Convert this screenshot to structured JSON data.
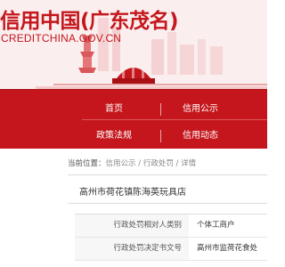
{
  "header": {
    "site_title": "信用中国(广东茂名)",
    "site_domain": "CREDITCHINA.GOV.CN"
  },
  "nav": {
    "items": [
      {
        "label": "首页"
      },
      {
        "label": "信用公示"
      },
      {
        "label": "政策法规"
      },
      {
        "label": "信用动态"
      }
    ]
  },
  "breadcrumb": {
    "lead": "当前位置：",
    "items": [
      "信用公示",
      "行政处罚",
      "详情"
    ],
    "separator": " / "
  },
  "record": {
    "title": "高州市荷花镇陈海英玩具店",
    "fields": [
      {
        "key": "行政处罚相对人类别",
        "value": "个体工商户"
      },
      {
        "key": "行政处罚决定书文号",
        "value": "高州市监荷花食处"
      }
    ]
  },
  "colors": {
    "brand_red": "#c4161c",
    "banner_bg": "#fbeeee"
  }
}
